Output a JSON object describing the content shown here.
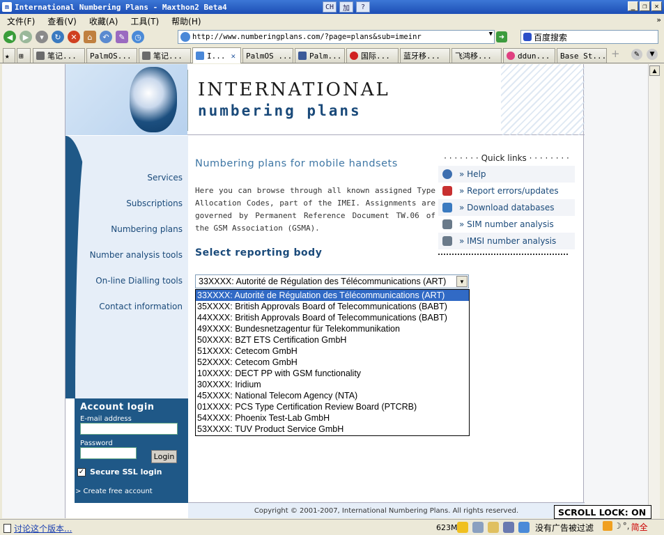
{
  "window": {
    "title": "International Numbering Plans - Maxthon2 Beta4",
    "mid_icons": [
      "CH",
      "加",
      "?"
    ]
  },
  "menubar": [
    "文件(F)",
    "查看(V)",
    "收藏(A)",
    "工具(T)",
    "帮助(H)"
  ],
  "toolbar": {
    "url": "http://www.numberingplans.com/?page=plans&sub=imeinr",
    "search_engine": "百度搜索"
  },
  "tabs": [
    {
      "label": "笔记...",
      "color": "#6b6b6b"
    },
    {
      "label": "PalmOS...",
      "color": "#ffffff"
    },
    {
      "label": "笔记...",
      "color": "#6b6b6b"
    },
    {
      "label": "I...",
      "color": "#4a88d8",
      "active": true
    },
    {
      "label": "PalmOS ...",
      "color": "#ffffff"
    },
    {
      "label": "Palm...",
      "color": "#3b5998"
    },
    {
      "label": "国际...",
      "color": "#d02020"
    },
    {
      "label": "蓝牙移...",
      "color": "#ffffff"
    },
    {
      "label": "飞鸿移...",
      "color": "#ffffff"
    },
    {
      "label": "ddun...",
      "color": "#e04080"
    },
    {
      "label": "Base St...",
      "color": "#ffffff"
    }
  ],
  "site": {
    "logo_line1": "INTERNATIONAL",
    "logo_line2": "numbering plans",
    "nav": [
      "Services",
      "Subscriptions",
      "Numbering plans",
      "Number analysis tools",
      "On-line Dialling tools",
      "Contact information"
    ],
    "login": {
      "title": "Account login",
      "email_label": "E-mail address",
      "password_label": "Password",
      "button": "Login",
      "ssl_label": "Secure SSL login",
      "free_account": "> Create free account"
    },
    "heading": "Numbering plans for mobile handsets",
    "intro": "Here you can browse through all known assigned Type Allocation Codes, part of the IMEI. Assignments are governed by Permanent Reference Document TW.06 of the GSM Association (GSMA).",
    "select_heading": "Select reporting body",
    "quick_links": {
      "title": "Quick links",
      "items": [
        {
          "label": "» Help",
          "icon": "help-icon",
          "color": "#3d6fb0"
        },
        {
          "label": "» Report errors/updates",
          "icon": "report-icon",
          "color": "#c83030"
        },
        {
          "label": "» Download databases",
          "icon": "download-icon",
          "color": "#3a7ac0"
        },
        {
          "label": "» SIM number analysis",
          "icon": "sim-analysis-icon",
          "color": "#6a7a8a"
        },
        {
          "label": "» IMSI number analysis",
          "icon": "imsi-analysis-icon",
          "color": "#6a7a8a"
        }
      ]
    },
    "select_value": "33XXXX: Autorité de Régulation des Télécommunications (ART)",
    "options": [
      "33XXXX: Autorité de Régulation des Télécommunications (ART)",
      "35XXXX: British Approvals Board of Telecommunications (BABT)",
      "44XXXX: British Approvals Board of Telecommunications (BABT)",
      "49XXXX: Bundesnetzagentur für Telekommunikation",
      "50XXXX: BZT ETS Certification GmbH",
      "51XXXX: Cetecom GmbH",
      "52XXXX: Cetecom GmbH",
      "10XXXX: DECT PP with GSM functionality",
      "30XXXX: Iridium",
      "45XXXX: National Telecom Agency (NTA)",
      "01XXXX: PCS Type Certification Review Board (PTCRB)",
      "54XXXX: Phoenix Test-Lab GmbH",
      "53XXXX: TUV Product Service GmbH"
    ],
    "footer": "Copyright © 2001-2007, International Numbering Plans. All rights reserved."
  },
  "status": {
    "link": "讨论这个版本...",
    "memory": "623M",
    "ad_text": "没有广告被过滤",
    "ime": "简全",
    "scroll_lock": "SCROLL LOCK: ON"
  }
}
